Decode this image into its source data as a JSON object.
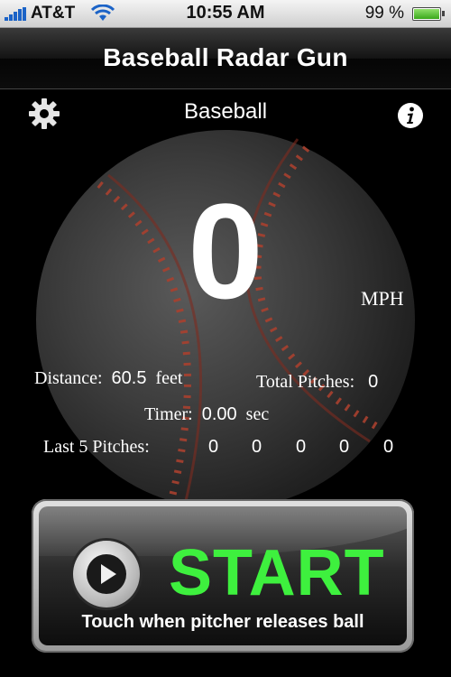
{
  "status_bar": {
    "carrier": "AT&T",
    "time": "10:55 AM",
    "battery": "99 %",
    "battery_level": 0.99
  },
  "nav": {
    "title": "Baseball Radar Gun"
  },
  "main": {
    "sport": "Baseball",
    "speed": "0",
    "unit": "MPH",
    "distance_label": "Distance:",
    "distance_value": "60.5",
    "distance_unit": "feet",
    "total_pitches_label": "Total Pitches:",
    "total_pitches_value": "0",
    "timer_label": "Timer:",
    "timer_value": "0.00",
    "timer_unit": "sec",
    "last5_label": "Last 5 Pitches:",
    "last5_values": [
      "0",
      "0",
      "0",
      "0",
      "0"
    ]
  },
  "start_button": {
    "label": "START",
    "hint": "Touch when pitcher releases ball"
  },
  "icons": {
    "settings": "gear-icon",
    "info": "info-icon",
    "play": "play-icon",
    "wifi": "wifi-icon",
    "signal": "signal-bars-icon",
    "battery": "battery-icon"
  },
  "colors": {
    "accent_green": "#3ef03e",
    "stitch_red": "#a8402f",
    "signal_blue": "#1b63c7"
  }
}
